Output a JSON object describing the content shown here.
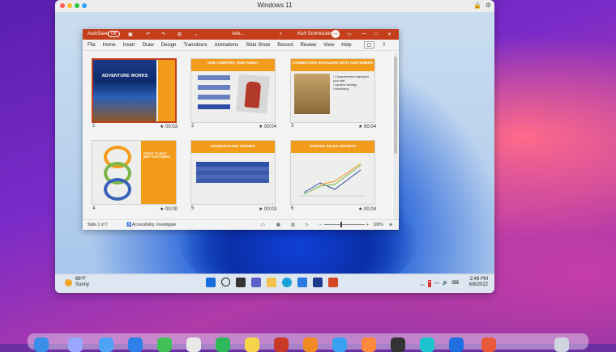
{
  "vm": {
    "title": "Windows 11"
  },
  "ppt": {
    "autosave": "AutoSave",
    "toggle": "Off",
    "doc_name": "Adv...",
    "user": "Kurt Schmucker",
    "user_initials": "KS",
    "menu": [
      "File",
      "Home",
      "Insert",
      "Draw",
      "Design",
      "Transitions",
      "Animations",
      "Slide Show",
      "Record",
      "Review",
      "View",
      "Help"
    ],
    "slides": [
      {
        "num": "1",
        "dur": "00:03",
        "title": "ADVENTURE WORKS",
        "body": ""
      },
      {
        "num": "2",
        "dur": "00:04",
        "title": "OUR COMPANY, OUR FAMILY",
        "body": ""
      },
      {
        "num": "3",
        "dur": "00:04",
        "title": "CONNECTING RETAILERS WITH CUSTOMERS",
        "body": "• Comprehensive training for your staff\n• Dynamic strategy\n• Advertising"
      },
      {
        "num": "4",
        "dur": "00:00",
        "title": "STRIVE TO BEST MEET CUSTOMERS",
        "body": ""
      },
      {
        "num": "5",
        "dur": "00:03",
        "title": "HANDCRAFTED FRAMES",
        "body": ""
      },
      {
        "num": "6",
        "dur": "00:04",
        "title": "STRONG SALES GROWTH",
        "body": ""
      }
    ],
    "status": {
      "slide": "Slide 1 of 7",
      "accessibility": "Accessibility: Investigate",
      "zoom": "100%"
    }
  },
  "taskbar": {
    "temp": "68°F",
    "cond": "Sunny",
    "time": "2:49 PM",
    "date": "6/8/2022"
  }
}
